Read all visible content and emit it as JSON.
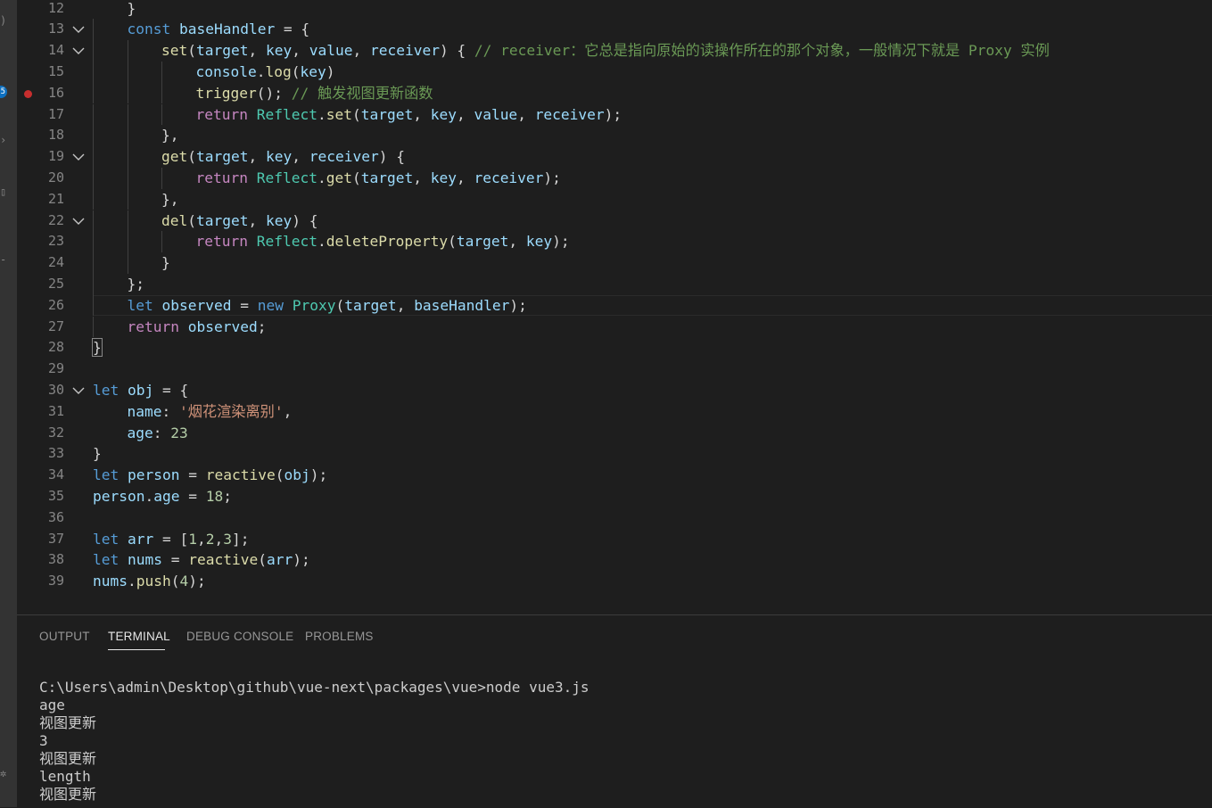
{
  "activity_bar": {
    "badge_count": "5",
    "icons": [
      "files-icon",
      "source-control-icon",
      "run-icon",
      "extensions-icon",
      "remote-icon",
      "settings-icon"
    ]
  },
  "editor": {
    "lines": [
      {
        "n": "12",
        "indent": 1,
        "tokens": [
          [
            "}",
            "op"
          ]
        ]
      },
      {
        "n": "13",
        "indent": 1,
        "fold": true,
        "tokens": [
          [
            "const",
            "kw"
          ],
          [
            " ",
            "op"
          ],
          [
            "baseHandler",
            "var"
          ],
          [
            " = {",
            "op"
          ]
        ]
      },
      {
        "n": "14",
        "indent": 2,
        "fold": true,
        "tokens": [
          [
            "set",
            "fn"
          ],
          [
            "(",
            "op"
          ],
          [
            "target",
            "var"
          ],
          [
            ", ",
            "op"
          ],
          [
            "key",
            "var"
          ],
          [
            ", ",
            "op"
          ],
          [
            "value",
            "var"
          ],
          [
            ", ",
            "op"
          ],
          [
            "receiver",
            "var"
          ],
          [
            ") { ",
            "op"
          ],
          [
            "// receiver：它总是指向原始的读操作所在的那个对象，一般情况下就是 Proxy 实例",
            "cmt"
          ]
        ]
      },
      {
        "n": "15",
        "indent": 3,
        "tokens": [
          [
            "console",
            "var"
          ],
          [
            ".",
            "op"
          ],
          [
            "log",
            "fn"
          ],
          [
            "(",
            "op"
          ],
          [
            "key",
            "var"
          ],
          [
            ")",
            "op"
          ]
        ]
      },
      {
        "n": "16",
        "indent": 3,
        "breakpoint": true,
        "tokens": [
          [
            "trigger",
            "fn"
          ],
          [
            "(); ",
            "op"
          ],
          [
            "// 触发视图更新函数",
            "cmt"
          ]
        ]
      },
      {
        "n": "17",
        "indent": 3,
        "tokens": [
          [
            "return",
            "ctl"
          ],
          [
            " ",
            "op"
          ],
          [
            "Reflect",
            "cls"
          ],
          [
            ".",
            "op"
          ],
          [
            "set",
            "fn"
          ],
          [
            "(",
            "op"
          ],
          [
            "target",
            "var"
          ],
          [
            ", ",
            "op"
          ],
          [
            "key",
            "var"
          ],
          [
            ", ",
            "op"
          ],
          [
            "value",
            "var"
          ],
          [
            ", ",
            "op"
          ],
          [
            "receiver",
            "var"
          ],
          [
            ");",
            "op"
          ]
        ]
      },
      {
        "n": "18",
        "indent": 2,
        "tokens": [
          [
            "},",
            "op"
          ]
        ]
      },
      {
        "n": "19",
        "indent": 2,
        "fold": true,
        "tokens": [
          [
            "get",
            "fn"
          ],
          [
            "(",
            "op"
          ],
          [
            "target",
            "var"
          ],
          [
            ", ",
            "op"
          ],
          [
            "key",
            "var"
          ],
          [
            ", ",
            "op"
          ],
          [
            "receiver",
            "var"
          ],
          [
            ") {",
            "op"
          ]
        ]
      },
      {
        "n": "20",
        "indent": 3,
        "tokens": [
          [
            "return",
            "ctl"
          ],
          [
            " ",
            "op"
          ],
          [
            "Reflect",
            "cls"
          ],
          [
            ".",
            "op"
          ],
          [
            "get",
            "fn"
          ],
          [
            "(",
            "op"
          ],
          [
            "target",
            "var"
          ],
          [
            ", ",
            "op"
          ],
          [
            "key",
            "var"
          ],
          [
            ", ",
            "op"
          ],
          [
            "receiver",
            "var"
          ],
          [
            ");",
            "op"
          ]
        ]
      },
      {
        "n": "21",
        "indent": 2,
        "tokens": [
          [
            "},",
            "op"
          ]
        ]
      },
      {
        "n": "22",
        "indent": 2,
        "fold": true,
        "tokens": [
          [
            "del",
            "fn"
          ],
          [
            "(",
            "op"
          ],
          [
            "target",
            "var"
          ],
          [
            ", ",
            "op"
          ],
          [
            "key",
            "var"
          ],
          [
            ") {",
            "op"
          ]
        ]
      },
      {
        "n": "23",
        "indent": 3,
        "tokens": [
          [
            "return",
            "ctl"
          ],
          [
            " ",
            "op"
          ],
          [
            "Reflect",
            "cls"
          ],
          [
            ".",
            "op"
          ],
          [
            "deleteProperty",
            "fn"
          ],
          [
            "(",
            "op"
          ],
          [
            "target",
            "var"
          ],
          [
            ", ",
            "op"
          ],
          [
            "key",
            "var"
          ],
          [
            ");",
            "op"
          ]
        ]
      },
      {
        "n": "24",
        "indent": 2,
        "tokens": [
          [
            "}",
            "op"
          ]
        ]
      },
      {
        "n": "25",
        "indent": 1,
        "tokens": [
          [
            "};",
            "op"
          ]
        ]
      },
      {
        "n": "26",
        "indent": 1,
        "current": true,
        "tokens": [
          [
            "let",
            "kw"
          ],
          [
            " ",
            "op"
          ],
          [
            "observed",
            "var"
          ],
          [
            " = ",
            "op"
          ],
          [
            "new",
            "kw"
          ],
          [
            " ",
            "op"
          ],
          [
            "Proxy",
            "cls"
          ],
          [
            "(",
            "op"
          ],
          [
            "target",
            "var"
          ],
          [
            ", ",
            "op"
          ],
          [
            "baseHandler",
            "var"
          ],
          [
            ");",
            "op"
          ]
        ]
      },
      {
        "n": "27",
        "indent": 1,
        "tokens": [
          [
            "return",
            "ctl"
          ],
          [
            " ",
            "op"
          ],
          [
            "observed",
            "var"
          ],
          [
            ";",
            "op"
          ]
        ]
      },
      {
        "n": "28",
        "indent": 0,
        "tokens": [
          [
            "}",
            "op"
          ]
        ],
        "bracket_box": true
      },
      {
        "n": "29",
        "indent": 0,
        "tokens": []
      },
      {
        "n": "30",
        "indent": 0,
        "fold": true,
        "tokens": [
          [
            "let",
            "kw"
          ],
          [
            " ",
            "op"
          ],
          [
            "obj",
            "var"
          ],
          [
            " = {",
            "op"
          ]
        ]
      },
      {
        "n": "31",
        "indent": 1,
        "tokens": [
          [
            "name",
            "var"
          ],
          [
            ": ",
            "op"
          ],
          [
            "'烟花渲染离别'",
            "str"
          ],
          [
            ",",
            "op"
          ]
        ]
      },
      {
        "n": "32",
        "indent": 1,
        "tokens": [
          [
            "age",
            "var"
          ],
          [
            ": ",
            "op"
          ],
          [
            "23",
            "num"
          ]
        ]
      },
      {
        "n": "33",
        "indent": 0,
        "tokens": [
          [
            "}",
            "op"
          ]
        ]
      },
      {
        "n": "34",
        "indent": 0,
        "tokens": [
          [
            "let",
            "kw"
          ],
          [
            " ",
            "op"
          ],
          [
            "person",
            "var"
          ],
          [
            " = ",
            "op"
          ],
          [
            "reactive",
            "fn"
          ],
          [
            "(",
            "op"
          ],
          [
            "obj",
            "var"
          ],
          [
            ");",
            "op"
          ]
        ]
      },
      {
        "n": "35",
        "indent": 0,
        "tokens": [
          [
            "person",
            "var"
          ],
          [
            ".",
            "op"
          ],
          [
            "age",
            "var"
          ],
          [
            " = ",
            "op"
          ],
          [
            "18",
            "num"
          ],
          [
            ";",
            "op"
          ]
        ]
      },
      {
        "n": "36",
        "indent": 0,
        "tokens": []
      },
      {
        "n": "37",
        "indent": 0,
        "tokens": [
          [
            "let",
            "kw"
          ],
          [
            " ",
            "op"
          ],
          [
            "arr",
            "var"
          ],
          [
            " = [",
            "op"
          ],
          [
            "1",
            "num"
          ],
          [
            ",",
            "op"
          ],
          [
            "2",
            "num"
          ],
          [
            ",",
            "op"
          ],
          [
            "3",
            "num"
          ],
          [
            "];",
            "op"
          ]
        ]
      },
      {
        "n": "38",
        "indent": 0,
        "tokens": [
          [
            "let",
            "kw"
          ],
          [
            " ",
            "op"
          ],
          [
            "nums",
            "var"
          ],
          [
            " = ",
            "op"
          ],
          [
            "reactive",
            "fn"
          ],
          [
            "(",
            "op"
          ],
          [
            "arr",
            "var"
          ],
          [
            ");",
            "op"
          ]
        ]
      },
      {
        "n": "39",
        "indent": 0,
        "tokens": [
          [
            "nums",
            "var"
          ],
          [
            ".",
            "op"
          ],
          [
            "push",
            "fn"
          ],
          [
            "(",
            "op"
          ],
          [
            "4",
            "num"
          ],
          [
            ");",
            "op"
          ]
        ]
      }
    ]
  },
  "panel": {
    "tabs": [
      {
        "label": "OUTPUT",
        "active": false
      },
      {
        "label": "TERMINAL",
        "active": true
      },
      {
        "label": "DEBUG CONSOLE",
        "active": false
      },
      {
        "label": "PROBLEMS",
        "active": false
      }
    ],
    "terminal_lines": [
      "C:\\Users\\admin\\Desktop\\github\\vue-next\\packages\\vue>node vue3.js",
      "age",
      "视图更新",
      "3",
      "视图更新",
      "length",
      "视图更新"
    ]
  },
  "colors": {
    "keyword": "#569cd6",
    "control": "#c586c0",
    "function": "#dcdcaa",
    "variable": "#9cdcfe",
    "class": "#4ec9b0",
    "string": "#ce9178",
    "number": "#b5cea8",
    "comment": "#6a9955"
  }
}
